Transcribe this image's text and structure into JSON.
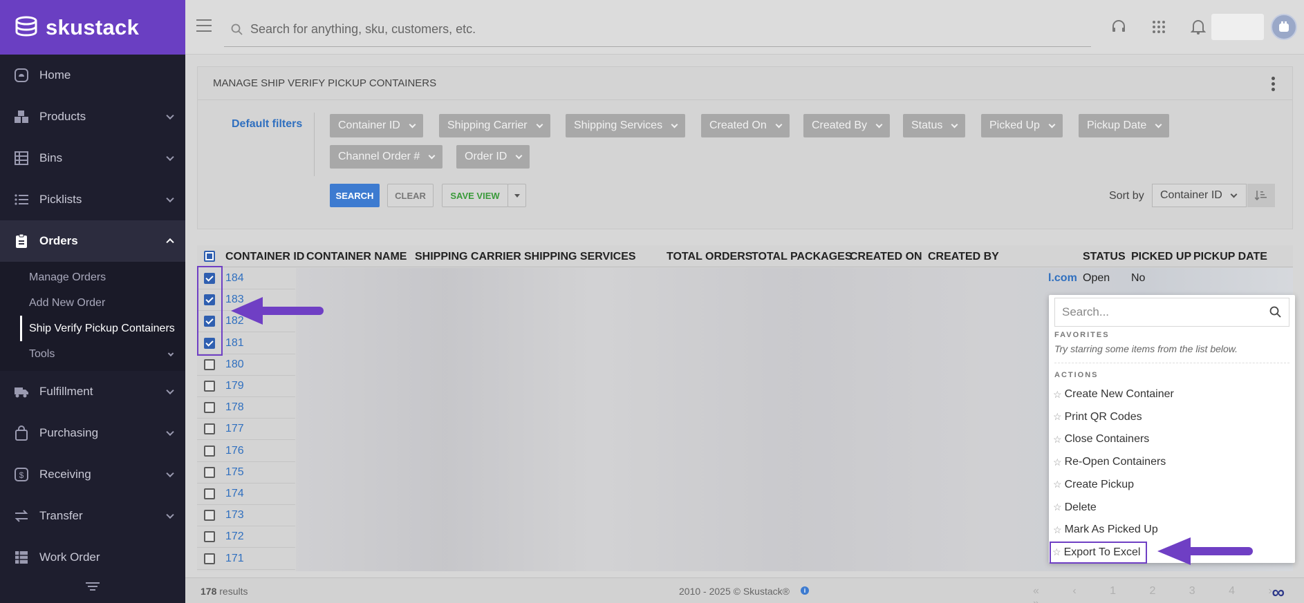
{
  "brand": {
    "name": "skustack"
  },
  "sidebar": {
    "items": [
      {
        "label": "Home",
        "icon": "home-icon",
        "has_children": false
      },
      {
        "label": "Products",
        "icon": "boxes-icon",
        "has_children": true
      },
      {
        "label": "Bins",
        "icon": "bins-icon",
        "has_children": true
      },
      {
        "label": "Picklists",
        "icon": "list-icon",
        "has_children": true
      },
      {
        "label": "Orders",
        "icon": "clipboard-icon",
        "has_children": true,
        "active": true
      }
    ],
    "orders_submenu": [
      {
        "label": "Manage Orders"
      },
      {
        "label": "Add New Order"
      },
      {
        "label": "Ship Verify Pickup Containers",
        "current": true
      },
      {
        "label": "Tools",
        "has_children": true
      }
    ],
    "items_after": [
      {
        "label": "Fulfillment",
        "icon": "truck-icon",
        "has_children": true
      },
      {
        "label": "Purchasing",
        "icon": "bag-icon",
        "has_children": true
      },
      {
        "label": "Receiving",
        "icon": "dollar-icon",
        "has_children": true
      },
      {
        "label": "Transfer",
        "icon": "transfer-icon",
        "has_children": true
      },
      {
        "label": "Work Order",
        "icon": "table-icon",
        "has_children": false
      }
    ]
  },
  "topbar": {
    "search_placeholder": "Search for anything, sku, customers, etc."
  },
  "panel": {
    "title": "MANAGE SHIP VERIFY PICKUP CONTAINERS",
    "default_filters_label": "Default filters",
    "filters_row1": [
      "Container ID",
      "Shipping Carrier",
      "Shipping Services",
      "Created On",
      "Created By",
      "Status",
      "Picked Up",
      "Pickup Date"
    ],
    "filters_row2": [
      "Channel Order #",
      "Order ID"
    ],
    "search_label": "SEARCH",
    "clear_label": "CLEAR",
    "save_view_label": "SAVE VIEW",
    "sort_by_label": "Sort by",
    "sort_by_value": "Container ID"
  },
  "table": {
    "headers": {
      "container_id": "CONTAINER ID",
      "container_name": "CONTAINER NAME",
      "shipping_carrier": "SHIPPING CARRIER",
      "shipping_services": "SHIPPING SERVICES",
      "total_orders": "TOTAL ORDERS",
      "total_packages": "TOTAL PACKAGES",
      "created_on": "CREATED ON",
      "created_by": "CREATED BY",
      "status": "STATUS",
      "picked_up": "PICKED UP",
      "pickup_date": "PICKUP DATE"
    },
    "rows": [
      {
        "id": "184",
        "checked": true
      },
      {
        "id": "183",
        "checked": true
      },
      {
        "id": "182",
        "checked": true
      },
      {
        "id": "181",
        "checked": true
      },
      {
        "id": "180",
        "checked": false
      },
      {
        "id": "179",
        "checked": false
      },
      {
        "id": "178",
        "checked": false
      },
      {
        "id": "177",
        "checked": false
      },
      {
        "id": "176",
        "checked": false
      },
      {
        "id": "175",
        "checked": false
      },
      {
        "id": "174",
        "checked": false
      },
      {
        "id": "173",
        "checked": false
      },
      {
        "id": "172",
        "checked": false
      },
      {
        "id": "171",
        "checked": false
      }
    ],
    "row184_tail": {
      "created_by": "l.com",
      "status": "Open",
      "picked_up": "No"
    }
  },
  "dropdown": {
    "search_placeholder": "Search...",
    "favorites_label": "FAVORITES",
    "favorites_hint": "Try starring some items from the list below.",
    "actions_label": "ACTIONS",
    "actions": [
      "Create New Container",
      "Print QR Codes",
      "Close Containers",
      "Re-Open Containers",
      "Create Pickup",
      "Delete",
      "Mark As Picked Up",
      "Export To Excel"
    ]
  },
  "footer": {
    "results_count": "178",
    "results_label": " results",
    "copyright": "2010 - 2025 © Skustack®",
    "pager": "« ‹ 1 2 3 4 › »"
  },
  "colors": {
    "brand_purple": "#6a3fc2",
    "sidebar_bg": "#1e1e2e",
    "link_blue": "#2f6fbf",
    "annotation_purple": "#6f3fc4"
  }
}
